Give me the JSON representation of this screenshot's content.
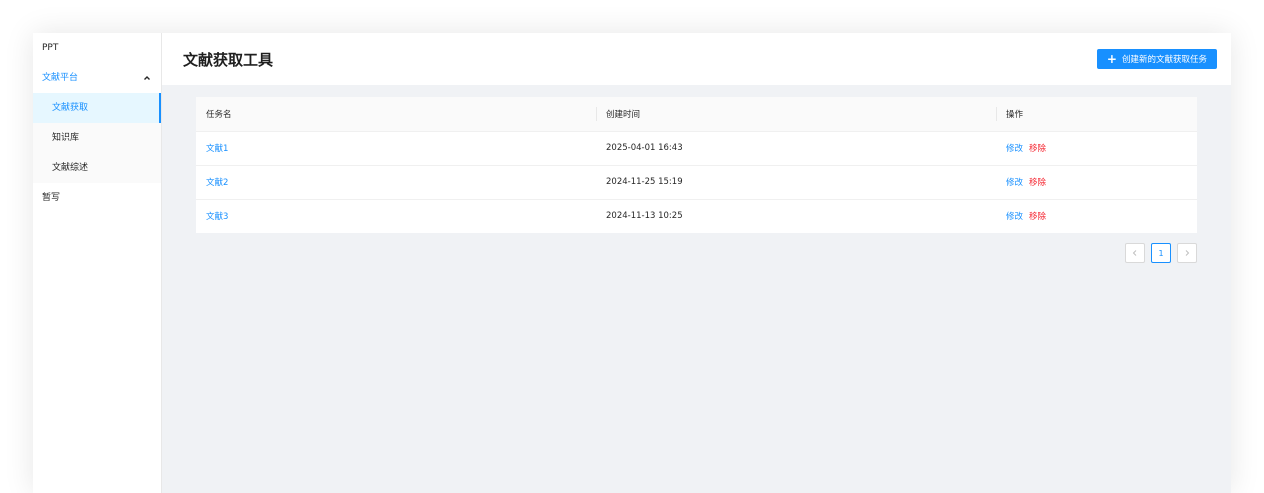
{
  "sidebar": {
    "items": [
      {
        "label": "PPT"
      },
      {
        "label": "文献平台",
        "expanded": true,
        "children": [
          {
            "label": "文献获取",
            "active": true
          },
          {
            "label": "知识库"
          },
          {
            "label": "文献综述"
          }
        ]
      },
      {
        "label": "暂写"
      }
    ]
  },
  "header": {
    "title": "文献获取工具",
    "create_button": "创建新的文献获取任务"
  },
  "table": {
    "columns": [
      "任务名",
      "创建时间",
      "操作"
    ],
    "rows": [
      {
        "name": "文献1",
        "created": "2025-04-01 16:43",
        "edit": "修改",
        "remove": "移除"
      },
      {
        "name": "文献2",
        "created": "2024-11-25 15:19",
        "edit": "修改",
        "remove": "移除"
      },
      {
        "name": "文献3",
        "created": "2024-11-13 10:25",
        "edit": "修改",
        "remove": "移除"
      }
    ]
  },
  "pagination": {
    "current": "1",
    "prev_icon": "chevron-left-icon",
    "next_icon": "chevron-right-icon"
  },
  "colors": {
    "primary": "#1890ff",
    "danger": "#f5222d"
  }
}
